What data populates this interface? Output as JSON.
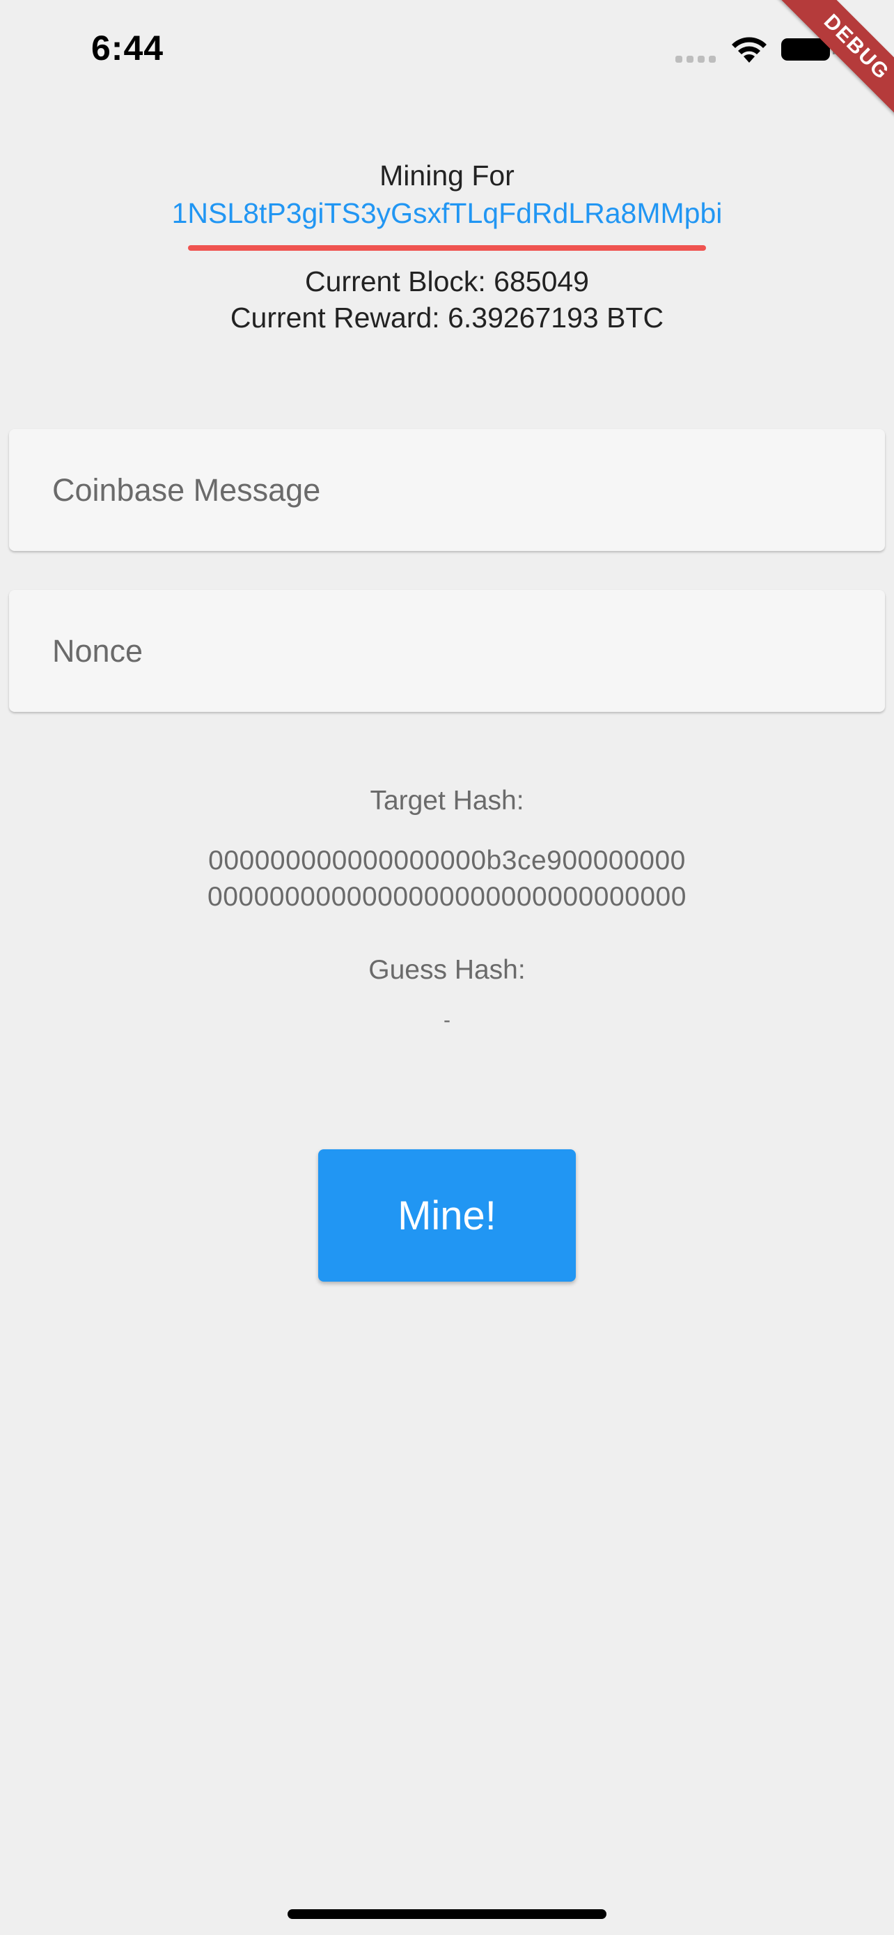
{
  "status_bar": {
    "time": "6:44"
  },
  "debug_banner": "DEBUG",
  "header": {
    "mining_for_label": "Mining For",
    "address": "1NSL8tP3giTS3yGsxfTLqFdRdLRa8MMpbi",
    "current_block": "Current Block: 685049",
    "current_reward": "Current Reward: 6.39267193 BTC"
  },
  "form": {
    "coinbase_placeholder": "Coinbase Message",
    "nonce_placeholder": "Nonce"
  },
  "hashes": {
    "target_label": "Target Hash:",
    "target_line1": "000000000000000000b3ce900000000",
    "target_line2": "0000000000000000000000000000000",
    "guess_label": "Guess Hash:",
    "guess_value": "-"
  },
  "actions": {
    "mine_label": "Mine!"
  },
  "colors": {
    "accent": "#2196f3",
    "underline": "#ef5350",
    "debug": "#b53b3b",
    "background": "#efefef"
  }
}
